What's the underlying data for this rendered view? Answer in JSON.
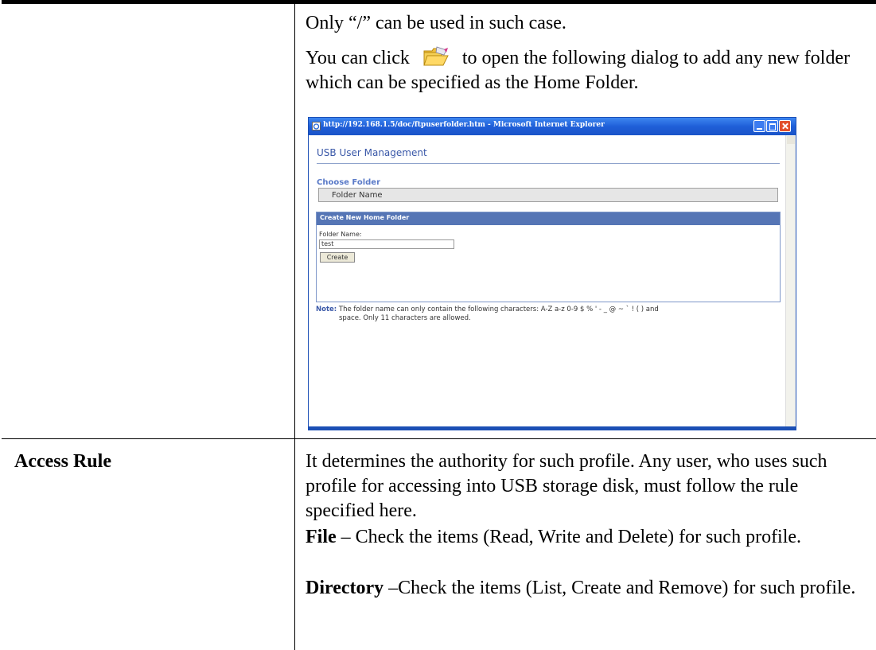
{
  "row1": {
    "line1": "Only “/” can be used in such case.",
    "p2_before": "You can click",
    "p2_after": "to open the following dialog to add any new folder which can be specified as the Home Folder."
  },
  "dialog": {
    "title": "http://192.168.1.5/doc/ftpuserfolder.htm - Microsoft Internet Explorer",
    "heading": "USB User Management",
    "choose_folder": "Choose Folder",
    "folder_column": "Folder Name",
    "create_panel_title": "Create New Home Folder",
    "folder_name_label": "Folder Name:",
    "folder_name_value": "test",
    "create_button": "Create",
    "note_label": "Note:",
    "note_line1": "The folder name can only contain the following characters: A-Z a-z 0-9 $ % ' - _ @ ~ ` ! ( ) and",
    "note_line2": "space. Only 11 characters are allowed."
  },
  "row2": {
    "label": "Access Rule",
    "p1": "It determines the authority for such profile. Any user, who uses such profile for accessing into USB storage disk, must follow the rule specified here.",
    "file_term": "File",
    "file_desc": " – Check the items (Read, Write and Delete) for such profile.",
    "dir_term": "Directory",
    "dir_desc": " –Check the items (List, Create and Remove) for such profile."
  }
}
